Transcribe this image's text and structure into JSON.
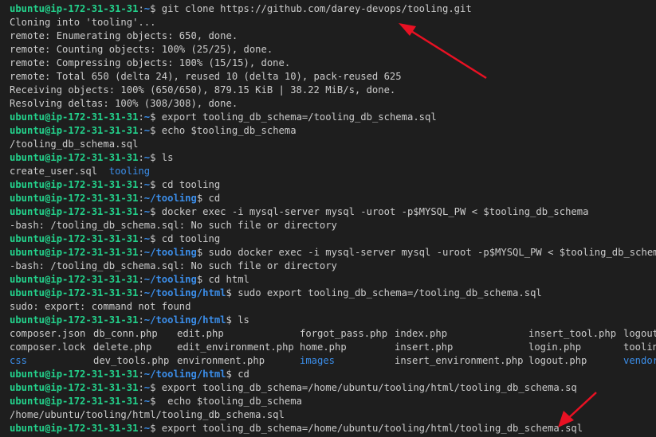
{
  "colors": {
    "background": "#1e1e1e",
    "text": "#cccccc",
    "prompt_user": "#23d18b",
    "prompt_path": "#3b8eea",
    "directory": "#3b8eea",
    "annotation_arrow": "#e81123"
  },
  "prompt": {
    "user_host": "ubuntu@ip-172-31-31-31",
    "colon": ":",
    "symbol": "$"
  },
  "lines": [
    {
      "type": "cmd",
      "cwd": "~",
      "cmd": " git clone https://github.com/darey-devops/tooling.git"
    },
    {
      "type": "out",
      "text": "Cloning into 'tooling'..."
    },
    {
      "type": "out",
      "text": "remote: Enumerating objects: 650, done."
    },
    {
      "type": "out",
      "text": "remote: Counting objects: 100% (25/25), done."
    },
    {
      "type": "out",
      "text": "remote: Compressing objects: 100% (15/15), done."
    },
    {
      "type": "out",
      "text": "remote: Total 650 (delta 24), reused 10 (delta 10), pack-reused 625"
    },
    {
      "type": "out",
      "text": "Receiving objects: 100% (650/650), 879.15 KiB | 38.22 MiB/s, done."
    },
    {
      "type": "out",
      "text": "Resolving deltas: 100% (308/308), done."
    },
    {
      "type": "cmd",
      "cwd": "~",
      "cmd": " export tooling_db_schema=/tooling_db_schema.sql"
    },
    {
      "type": "cmd",
      "cwd": "~",
      "cmd": " echo $tooling_db_schema"
    },
    {
      "type": "out",
      "text": "/tooling_db_schema.sql"
    },
    {
      "type": "cmd",
      "cwd": "~",
      "cmd": " ls"
    },
    {
      "type": "lsmix",
      "parts": [
        {
          "text": "create_user.sql  ",
          "dir": false
        },
        {
          "text": "tooling",
          "dir": true
        }
      ]
    },
    {
      "type": "cmd",
      "cwd": "~",
      "cmd": " cd tooling"
    },
    {
      "type": "cmd",
      "cwd": "~/tooling",
      "cmd": " cd"
    },
    {
      "type": "cmd",
      "cwd": "~",
      "cmd": " docker exec -i mysql-server mysql -uroot -p$MYSQL_PW < $tooling_db_schema"
    },
    {
      "type": "out",
      "text": "-bash: /tooling_db_schema.sql: No such file or directory"
    },
    {
      "type": "cmd",
      "cwd": "~",
      "cmd": " cd tooling"
    },
    {
      "type": "cmd",
      "cwd": "~/tooling",
      "cmd": " sudo docker exec -i mysql-server mysql -uroot -p$MYSQL_PW < $tooling_db_schema"
    },
    {
      "type": "out",
      "text": "-bash: /tooling_db_schema.sql: No such file or directory"
    },
    {
      "type": "cmd",
      "cwd": "~/tooling",
      "cmd": " cd html"
    },
    {
      "type": "cmd",
      "cwd": "~/tooling/html",
      "cmd": " sudo export tooling_db_schema=/tooling_db_schema.sql"
    },
    {
      "type": "out",
      "text": "sudo: export: command not found"
    },
    {
      "type": "cmd",
      "cwd": "~/tooling/html",
      "cmd": " ls"
    },
    {
      "type": "lsrow",
      "cells": [
        {
          "text": "composer.json",
          "dir": false
        },
        {
          "text": "db_conn.php",
          "dir": false
        },
        {
          "text": "edit.php",
          "dir": false
        },
        {
          "text": "forgot_pass.php",
          "dir": false
        },
        {
          "text": "index.php",
          "dir": false
        },
        {
          "text": "insert_tool.php",
          "dir": false
        },
        {
          "text": "logout",
          "dir": false
        }
      ]
    },
    {
      "type": "lsrow",
      "cells": [
        {
          "text": "composer.lock",
          "dir": false
        },
        {
          "text": "delete.php",
          "dir": false
        },
        {
          "text": "edit_environment.php",
          "dir": false
        },
        {
          "text": "home.php",
          "dir": false
        },
        {
          "text": "insert.php",
          "dir": false
        },
        {
          "text": "login.php",
          "dir": false
        },
        {
          "text": "toolin",
          "dir": false
        }
      ]
    },
    {
      "type": "lsrow",
      "cells": [
        {
          "text": "css",
          "dir": true
        },
        {
          "text": "dev_tools.php",
          "dir": false
        },
        {
          "text": "environment.php",
          "dir": false
        },
        {
          "text": "images",
          "dir": true
        },
        {
          "text": "insert_environment.php",
          "dir": false
        },
        {
          "text": "logout.php",
          "dir": false
        },
        {
          "text": "vendor",
          "dir": true
        }
      ]
    },
    {
      "type": "cmd",
      "cwd": "~/tooling/html",
      "cmd": " cd"
    },
    {
      "type": "cmd",
      "cwd": "~",
      "cmd": " export tooling_db_schema=/home/ubuntu/tooling/html/tooling_db_schema.sq"
    },
    {
      "type": "cmd",
      "cwd": "~",
      "cmd": "  echo $tooling_db_schema"
    },
    {
      "type": "out",
      "text": "/home/ubuntu/tooling/html/tooling_db_schema.sql"
    },
    {
      "type": "cmd",
      "cwd": "~",
      "cmd": " export tooling_db_schema=/home/ubuntu/tooling/html/tooling_db_schema.sql"
    }
  ]
}
